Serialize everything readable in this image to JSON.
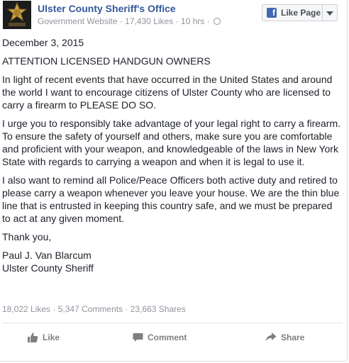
{
  "post": {
    "page_name": "Ulster County Sheriff's Office",
    "category": "Government Website",
    "likes": "17,430 Likes",
    "time": "10 hrs",
    "like_page_label": "Like Page",
    "paragraphs": [
      "December 3, 2015",
      "ATTENTION LICENSED HANDGUN OWNERS",
      "In light of recent events that have occurred in the United States and around the world I want to encourage citizens of Ulster County who are licensed to carry a firearm to PLEASE DO SO.",
      "I urge you to responsibly take advantage of your legal right to carry a firearm. To ensure the safety of yourself and others, make sure you are comfortable and proficient with your weapon, and knowledgeable of the laws in New York State with regards to carrying a weapon and when it is legal to use it.",
      "I also want to remind all Police/Peace Officers both active duty and retired to please carry a weapon whenever you leave your house. We are the thin blue line that is entrusted in keeping this country safe, and we must be prepared to act at any given moment.",
      "Thank you,"
    ],
    "signature_name": "Paul J. Van Blarcum",
    "signature_title": "Ulster County Sheriff",
    "stats": "18,022 Likes · 5,347 Comments · 23,663 Shares"
  },
  "actions": {
    "like": "Like",
    "comment": "Comment",
    "share": "Share"
  }
}
